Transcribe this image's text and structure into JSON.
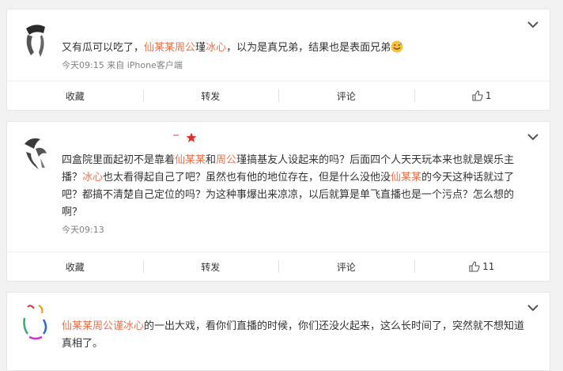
{
  "posts": [
    {
      "segments": [
        {
          "t": "又有瓜可以吃了，",
          "hl": false
        },
        {
          "t": "仙某某",
          "hl": true
        },
        {
          "t": "周公",
          "hl": true
        },
        {
          "t": "瑾",
          "hl": false
        },
        {
          "t": "冰心",
          "hl": true
        },
        {
          "t": "，以为是真兄弟，结果也是表面兄弟",
          "hl": false
        }
      ],
      "meta": "今天09:15 来自 iPhone客户端",
      "actions": {
        "favorite": "收藏",
        "repost": "转发",
        "comment": "评论",
        "like_count": "1"
      }
    },
    {
      "segments": [
        {
          "t": "四盒院里面起初不是靠着",
          "hl": false
        },
        {
          "t": "仙某某",
          "hl": true
        },
        {
          "t": "和",
          "hl": false
        },
        {
          "t": "周公",
          "hl": true
        },
        {
          "t": "瑾搞基友人设起来的吗？后面四个人天天玩本来也就是娱乐主播？",
          "hl": false
        },
        {
          "t": "冰心",
          "hl": true
        },
        {
          "t": "也太看得起自己了吧？虽然也有他的地位存在，但是什么没他没",
          "hl": false
        },
        {
          "t": "仙某某",
          "hl": true
        },
        {
          "t": "的今天这种话就过了吧？都搞不清楚自己定位的吗？为这种事爆出来凉凉，以后就算是单飞直播也是一个污点？怎么想的啊？",
          "hl": false
        }
      ],
      "meta": "今天09:13",
      "actions": {
        "favorite": "收藏",
        "repost": "转发",
        "comment": "评论",
        "like_count": "11"
      }
    },
    {
      "segments": [
        {
          "t": "仙某某周公谨冰心",
          "hl": true
        },
        {
          "t": "的一出大戏，看你们直播的时候，你们还没火起来，这么长时间了，突然就不想知道真相了。",
          "hl": false
        }
      ]
    }
  ],
  "colors": {
    "highlight": "#eb7350",
    "text": "#333333",
    "meta": "#808080"
  }
}
